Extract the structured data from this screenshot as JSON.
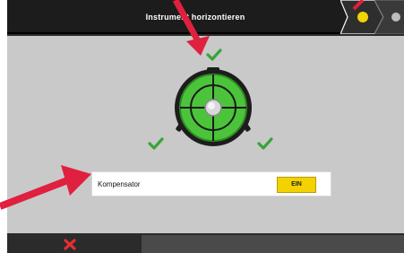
{
  "header": {
    "title": "Instrument horizontieren",
    "steps": [
      {
        "name": "current-step",
        "state": "active",
        "color": "#f2d200"
      },
      {
        "name": "next-step",
        "state": "inactive",
        "color": "#bdbdbd"
      }
    ]
  },
  "level": {
    "bubble_color": "#4bc43b",
    "checks": [
      "top",
      "left",
      "right"
    ],
    "check_color": "#3aa33a"
  },
  "compensator": {
    "label": "Kompensator",
    "toggle_label": "EIN",
    "toggle_color": "#f2d200"
  },
  "footer": {
    "cancel_icon": "close-icon",
    "cancel_color": "#e03030"
  },
  "annotations": {
    "arrow_color": "#e0203f"
  }
}
